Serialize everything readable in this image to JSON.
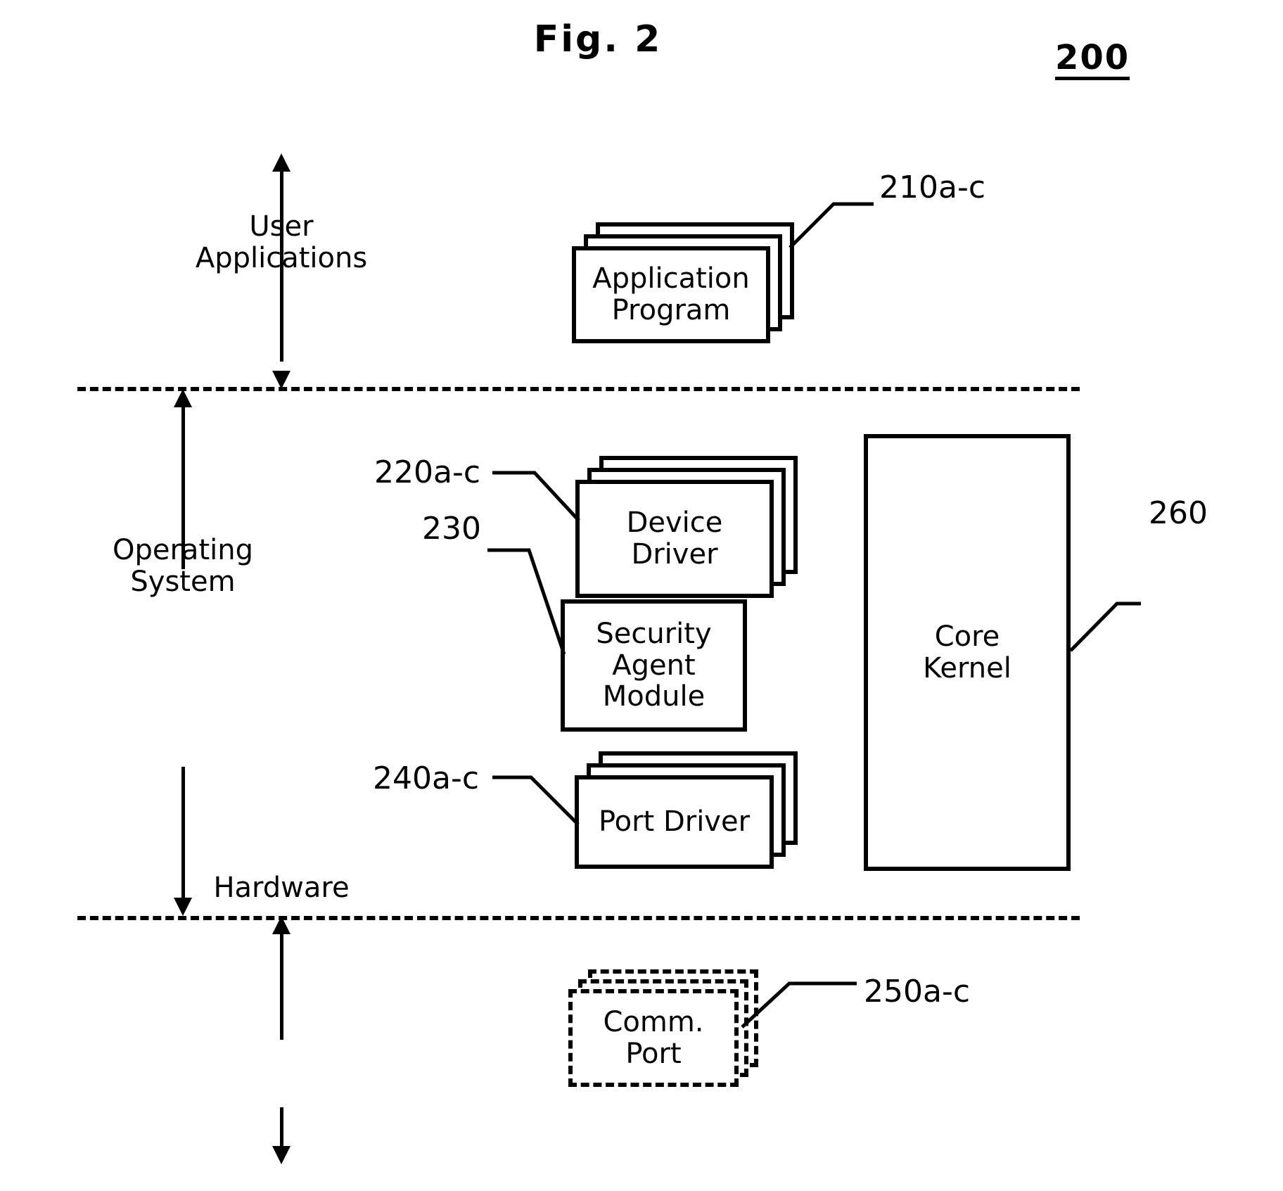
{
  "figure": {
    "title": "Fig. 2",
    "number": "200"
  },
  "bands": [
    {
      "id": "user",
      "label": "User\nApplications"
    },
    {
      "id": "os",
      "label": "Operating\nSystem"
    },
    {
      "id": "hardware",
      "label": "Hardware"
    }
  ],
  "blocks": {
    "application_program": {
      "label": "Application\nProgram",
      "ref": "210a-c",
      "stacked": true,
      "style": "solid"
    },
    "device_driver": {
      "label": "Device\nDriver",
      "ref": "220a-c",
      "stacked": true,
      "style": "solid"
    },
    "security_agent": {
      "label": "Security\nAgent\nModule",
      "ref": "230",
      "stacked": false,
      "style": "solid"
    },
    "port_driver": {
      "label": "Port Driver",
      "ref": "240a-c",
      "stacked": true,
      "style": "solid"
    },
    "comm_port": {
      "label": "Comm. Port",
      "ref": "250a-c",
      "stacked": true,
      "style": "dashed"
    },
    "core_kernel": {
      "label": "Core\nKernel",
      "ref": "260",
      "stacked": false,
      "style": "solid"
    }
  },
  "colors": {
    "ink": "#000000",
    "paper": "#ffffff"
  }
}
